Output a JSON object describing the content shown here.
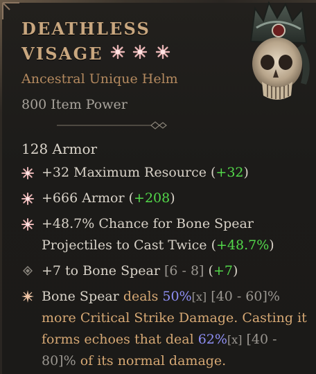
{
  "item": {
    "name_line1": "DEATHLESS",
    "name_line2": "VISAGE",
    "subtitle": "Ancestral Unique Helm",
    "item_power": "800 Item Power",
    "armor": "128 Armor",
    "greater_affix_stars": 3,
    "icon": "skull-helm-icon"
  },
  "affixes": [
    {
      "text": "+32 Maximum Resource",
      "bonus": "+32"
    },
    {
      "text": "+666 Armor",
      "bonus": "+208"
    },
    {
      "text_line1": "+48.7% Chance for Bone Spear",
      "text_line2": "Projectiles to Cast Twice",
      "bonus": "+48.7%"
    },
    {
      "prefix": "+7 to Bone Spear",
      "range": "[6 - 8]",
      "bonus": "+7"
    }
  ],
  "unique_power": {
    "part1": "Bone Spear",
    "part2": "deals",
    "value1": "50%",
    "x1": "[x]",
    "range1": "[40 - 60]%",
    "part3": "more Critical Strike Damage. Casting it forms echoes that deal",
    "value2": "62%",
    "x2": "[x]",
    "range2": "[40 - 80]%",
    "part4": "of its normal damage."
  },
  "colors": {
    "title": "#c9a77f",
    "subtitle": "#b48a5f",
    "bonus_green": "#53d94a",
    "unique_tan": "#d6a874",
    "value_blue": "#8f8ff5",
    "bracket_gray": "#9a9690",
    "greater_affix_star": "#e8b4b4"
  }
}
